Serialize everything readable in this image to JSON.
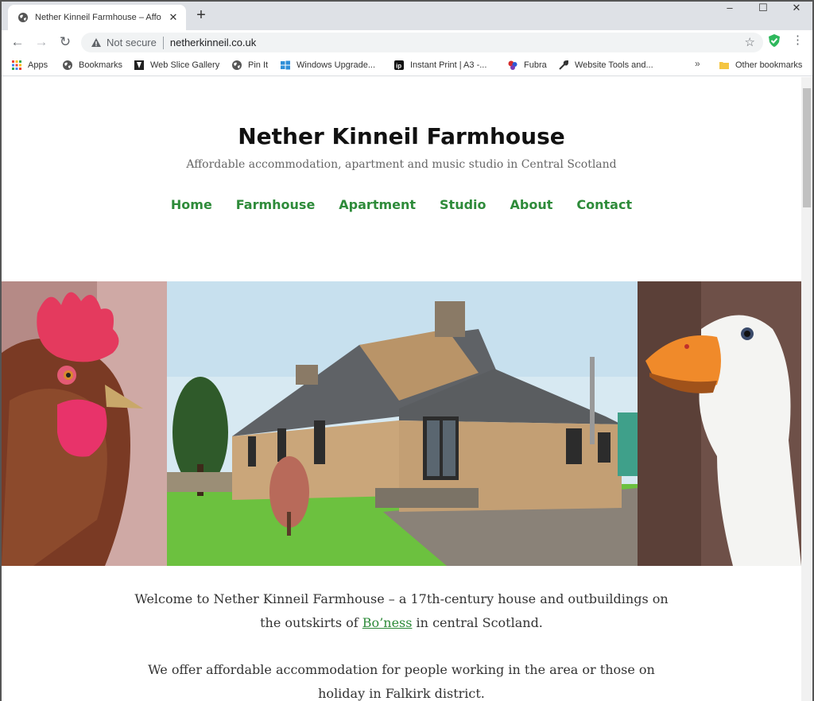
{
  "browser": {
    "tab_title": "Nether Kinneil Farmhouse – Affo",
    "new_tab": "+",
    "window_controls": {
      "minimize": "–",
      "maximize": "☐",
      "close": "✕"
    },
    "security_label": "Not secure",
    "url": "netherkinneil.co.uk",
    "bookmarks": [
      {
        "label": "Apps",
        "icon": "apps-grid-icon"
      },
      {
        "label": "Bookmarks",
        "icon": "globe-icon"
      },
      {
        "label": "Web Slice Gallery",
        "icon": "web-slice-icon"
      },
      {
        "label": "Pin It",
        "icon": "globe-icon"
      },
      {
        "label": "Windows Upgrade...",
        "icon": "windows-logo-icon"
      },
      {
        "label": "Instant Print | A3 -...",
        "icon": "ip-logo-icon"
      },
      {
        "label": "Fubra",
        "icon": "fubra-logo-icon"
      },
      {
        "label": "Website Tools and...",
        "icon": "wrench-icon"
      }
    ],
    "overflow": "»",
    "other_bookmarks": "Other bookmarks"
  },
  "site": {
    "title": "Nether Kinneil Farmhouse",
    "tagline": "Affordable accommodation, apartment and music studio in Central Scotland",
    "nav": [
      "Home",
      "Farmhouse",
      "Apartment",
      "Studio",
      "About",
      "Contact"
    ]
  },
  "intro": {
    "p1_before": "Welcome to Nether Kinneil Farmhouse – a 17th-century house and outbuildings on",
    "p1_line2_before": "the outskirts of ",
    "p1_link": "Bo’ness",
    "p1_after": " in central Scotland.",
    "p2_line1": "We offer affordable accommodation for people working in the area or those on",
    "p2_line2": "holiday in Falkirk district."
  },
  "colors": {
    "link_green": "#2e8b3a",
    "chrome_bg": "#dee1e6",
    "omnibox_bg": "#f1f3f4"
  }
}
